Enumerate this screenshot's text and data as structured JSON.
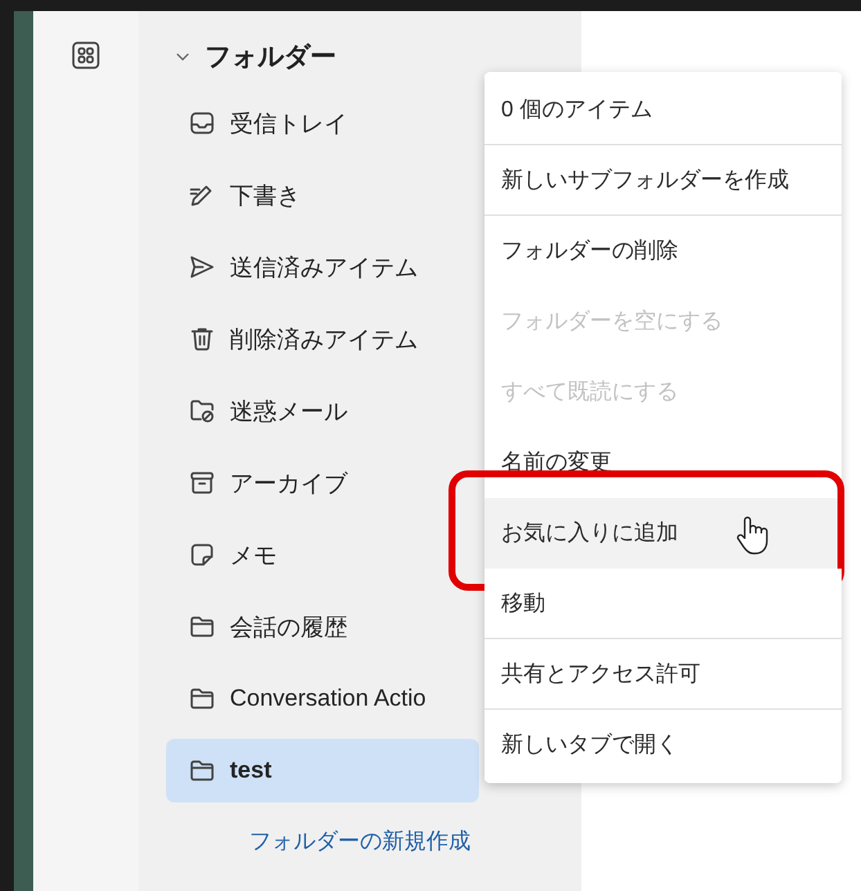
{
  "folders": {
    "title": "フォルダー",
    "expanded": true,
    "items": [
      {
        "label": "受信トレイ",
        "kind": "inbox",
        "selected": false
      },
      {
        "label": "下書き",
        "kind": "drafts",
        "selected": false
      },
      {
        "label": "送信済みアイテム",
        "kind": "sent",
        "selected": false
      },
      {
        "label": "削除済みアイテム",
        "kind": "deleted",
        "selected": false
      },
      {
        "label": "迷惑メール",
        "kind": "junk",
        "selected": false
      },
      {
        "label": "アーカイブ",
        "kind": "archive",
        "selected": false
      },
      {
        "label": "メモ",
        "kind": "notes",
        "selected": false
      },
      {
        "label": "会話の履歴",
        "kind": "folder",
        "selected": false
      },
      {
        "label": "Conversation Actio",
        "kind": "folder",
        "selected": false
      },
      {
        "label": "test",
        "kind": "folder",
        "selected": true
      }
    ],
    "new_folder": "フォルダーの新規作成"
  },
  "context_menu": {
    "items": [
      {
        "label": "0 個のアイテム",
        "disabled": false,
        "hovered": false,
        "divider_after": true,
        "annotated": false
      },
      {
        "label": "新しいサブフォルダーを作成",
        "disabled": false,
        "hovered": false,
        "divider_after": true,
        "annotated": false
      },
      {
        "label": "フォルダーの削除",
        "disabled": false,
        "hovered": false,
        "divider_after": false,
        "annotated": false
      },
      {
        "label": "フォルダーを空にする",
        "disabled": true,
        "hovered": false,
        "divider_after": false,
        "annotated": false
      },
      {
        "label": "すべて既読にする",
        "disabled": true,
        "hovered": false,
        "divider_after": false,
        "annotated": false
      },
      {
        "label": "名前の変更",
        "disabled": false,
        "hovered": false,
        "divider_after": false,
        "annotated": false
      },
      {
        "label": "お気に入りに追加",
        "disabled": false,
        "hovered": true,
        "divider_after": false,
        "annotated": true
      },
      {
        "label": "移動",
        "disabled": false,
        "hovered": false,
        "divider_after": true,
        "annotated": false
      },
      {
        "label": "共有とアクセス許可",
        "disabled": false,
        "hovered": false,
        "divider_after": true,
        "annotated": false
      },
      {
        "label": "新しいタブで開く",
        "disabled": false,
        "hovered": false,
        "divider_after": false,
        "annotated": false
      }
    ]
  }
}
